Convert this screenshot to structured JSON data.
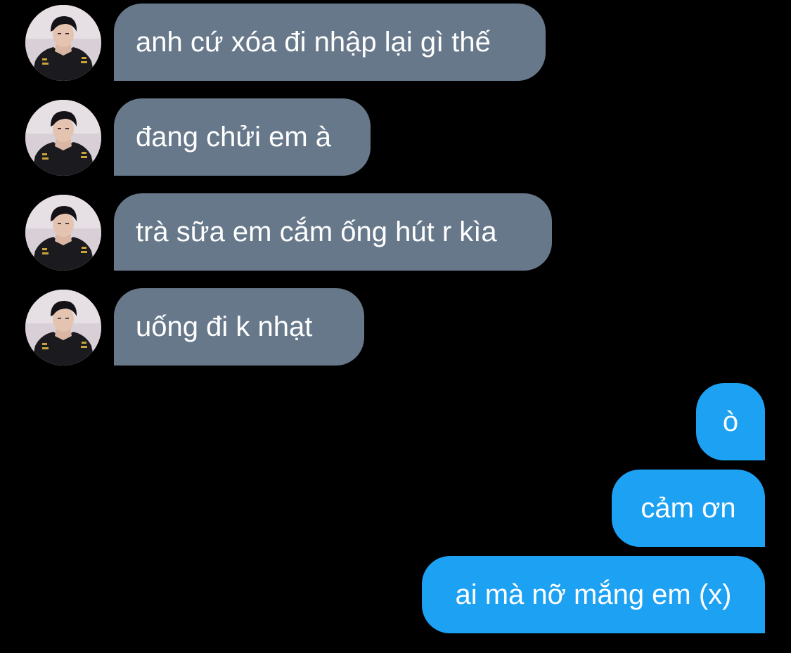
{
  "colors": {
    "background": "#000000",
    "incoming_bubble": "#66788a",
    "outgoing_bubble": "#1da1f2",
    "text": "#ffffff"
  },
  "conversation": {
    "incoming": [
      {
        "text": "anh cứ xóa đi nhập lại gì thế",
        "avatar_icon": "profile-photo"
      },
      {
        "text": "đang chửi em à",
        "avatar_icon": "profile-photo"
      },
      {
        "text": "trà sữa em cắm ống hút r kìa",
        "avatar_icon": "profile-photo"
      },
      {
        "text": "uống đi k nhạt",
        "avatar_icon": "profile-photo"
      }
    ],
    "outgoing": [
      {
        "text": "ò"
      },
      {
        "text": "cảm ơn"
      },
      {
        "text": "ai mà nỡ mắng em (x)"
      }
    ]
  }
}
